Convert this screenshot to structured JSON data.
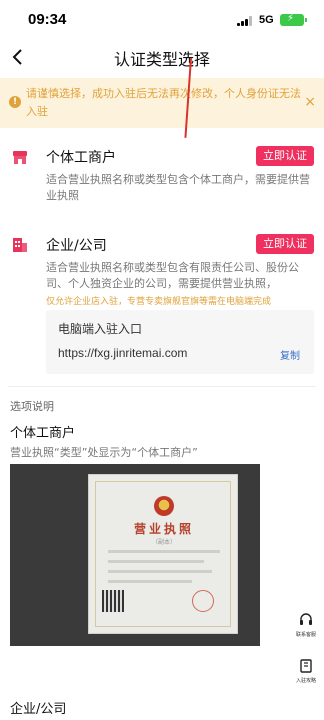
{
  "status_bar": {
    "time": "09:34",
    "network": "5G"
  },
  "nav": {
    "title": "认证类型选择"
  },
  "notice": {
    "text": "请谨慎选择，成功入驻后无法再次修改，个人身份证无法入驻",
    "icon": "info-icon",
    "close": "×"
  },
  "options": [
    {
      "title": "个体工商户",
      "button": "立即认证",
      "description": "适合营业执照名称或类型包含个体工商户，需要提供营业执照",
      "icon": "shop-icon"
    },
    {
      "title": "企业/公司",
      "button": "立即认证",
      "description": "适合营业执照名称或类型包含有限责任公司、股份公司、个人独资企业的公司，需要提供营业执照，",
      "note": "仅允许企业店入驻，专营专卖旗舰官旗等需在电脑端完成",
      "icon": "building-icon"
    }
  ],
  "pc_entry": {
    "title": "电脑端入驻入口",
    "url": "https://fxg.jinritemai.com",
    "copy": "复制"
  },
  "explanation": {
    "label": "选项说明",
    "heading": "个体工商户",
    "description": "营业执照“类型”处显示为“个体工商户”",
    "license_title": "营业执照",
    "license_sub": "（副本）"
  },
  "tools": [
    {
      "label": "联系客服",
      "icon": "headset-icon"
    },
    {
      "label": "入驻攻略",
      "icon": "guide-book-icon"
    }
  ],
  "bottom_heading": "企业/公司"
}
